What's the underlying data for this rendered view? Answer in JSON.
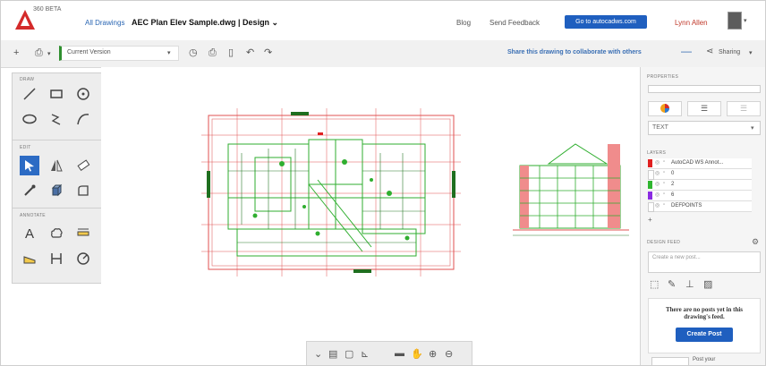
{
  "header": {
    "logo_text": "360 BETA",
    "all_drawings": "All Drawings",
    "file_title": "AEC Plan Elev Sample.dwg | Design ⌄",
    "blog": "Blog",
    "send_feedback": "Send Feedback",
    "goto_button": "Go to autocadws.com",
    "user_name": "Lynn Allen"
  },
  "toolbar": {
    "version_label": "Current Version",
    "share_text": "Share this drawing to collaborate with others",
    "sharing_label": "Sharing"
  },
  "tools": {
    "draw_title": "DRAW",
    "edit_title": "EDIT",
    "annotate_title": "ANNOTATE",
    "text_tool": "A"
  },
  "right_panel": {
    "properties_title": "PROPERTIES",
    "text_select": "TEXT",
    "layers_title": "LAYERS",
    "layers": [
      {
        "name": "AutoCAD WS Annot...",
        "color": "#e02020"
      },
      {
        "name": "0",
        "color": "#ffffff"
      },
      {
        "name": "2",
        "color": "#2fb52f"
      },
      {
        "name": "6",
        "color": "#8a2be2"
      },
      {
        "name": "DEFPOINTS",
        "color": "#ffffff"
      }
    ],
    "design_feed_title": "DESIGN FEED",
    "post_placeholder": "Create a new post...",
    "no_posts_msg": "There are no posts yet in this drawing's feed.",
    "create_post": "Create Post",
    "post_your": "Post your"
  },
  "colors": {
    "accent_blue": "#1f5fbf",
    "plan_red": "#e05050",
    "plan_green": "#2fae2f"
  }
}
